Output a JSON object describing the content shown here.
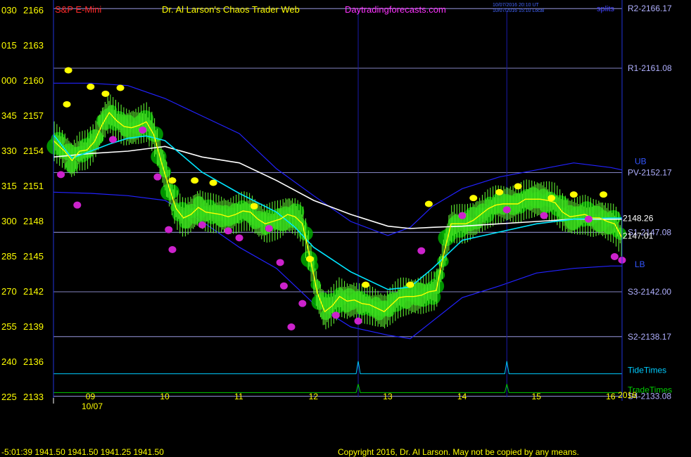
{
  "header": {
    "symbol": "S&P E-Mini",
    "title": "Dr. Al Larson's Chaos Trader Web",
    "site": "Daytradingforecasts.com",
    "stamp_line1": "10/07/2016 20:10 UT",
    "stamp_line2": "10/07/2016 15:10 Local",
    "corner_tag": "splits"
  },
  "footer": {
    "quote": "-5:01:39  1941.50  1941.50  1941.25  1941.50",
    "copyright": "Copyright 2016, Dr. Al Larson. May not be copied by any means."
  },
  "colors": {
    "background": "#000000",
    "price_line": "#ffff00",
    "ema_cyan": "#00e5ff",
    "ema_white": "#ffffff",
    "bands": "#2222ff",
    "pivot_lines": "#b0b0ff",
    "tide_times": "#00ccff",
    "trade_times": "#00cc00",
    "green_blob": "#00aa00",
    "magenta_marker": "#cc22cc",
    "yellow_marker": "#ffff00"
  },
  "chart_data": {
    "type": "line",
    "title": "S&P E-Mini",
    "ylim": [
      2133,
      2166
    ],
    "xlim": [
      8.5,
      16.15
    ],
    "date_label": "10/07",
    "year_label": "2016",
    "left_axis_ticks": [
      {
        "time": "030",
        "price": "2166"
      },
      {
        "time": "015",
        "price": "2163"
      },
      {
        "time": "000",
        "price": "2160"
      },
      {
        "time": "345",
        "price": "2157"
      },
      {
        "time": "330",
        "price": "2154"
      },
      {
        "time": "315",
        "price": "2151"
      },
      {
        "time": "300",
        "price": "2148"
      },
      {
        "time": "285",
        "price": "2145"
      },
      {
        "time": "270",
        "price": "2142"
      },
      {
        "time": "255",
        "price": "2139"
      },
      {
        "time": "240",
        "price": "2136"
      },
      {
        "time": "225",
        "price": "2133"
      }
    ],
    "x_ticks": [
      {
        "label": "09",
        "x": 9
      },
      {
        "label": "10",
        "x": 10
      },
      {
        "label": "11",
        "x": 11
      },
      {
        "label": "12",
        "x": 12
      },
      {
        "label": "13",
        "x": 13
      },
      {
        "label": "14",
        "x": 14
      },
      {
        "label": "15",
        "x": 15
      },
      {
        "label": "16",
        "x": 16
      }
    ],
    "levels": [
      {
        "label": "R2-2166.17",
        "value": 2166.17
      },
      {
        "label": "R1-2161.08",
        "value": 2161.08
      },
      {
        "label": "PV-2152.17",
        "value": 2152.17
      },
      {
        "label": "S1-2147.08",
        "value": 2147.08
      },
      {
        "label": "S3-2142.00",
        "value": 2142.0
      },
      {
        "label": "S2-2138.17",
        "value": 2138.17
      },
      {
        "label": "S4-2133.08",
        "value": 2133.08
      }
    ],
    "band_labels": {
      "upper": "UB",
      "lower": "LB"
    },
    "ema_values": [
      "2148.26",
      "2147.01"
    ],
    "timing_lines": [
      {
        "label": "TideTimes",
        "value": 2135.0,
        "peaks_x": [
          12.6,
          14.6
        ]
      },
      {
        "label": "TradeTimes",
        "value": 2133.4,
        "peaks_x": [
          12.6,
          14.6
        ]
      }
    ],
    "vertical_markers_x": [
      12.6,
      14.6
    ],
    "series": [
      {
        "key": "price",
        "x": [
          8.5,
          8.65,
          8.75,
          8.85,
          8.95,
          9.05,
          9.15,
          9.25,
          9.35,
          9.45,
          9.55,
          9.65,
          9.75,
          9.85,
          9.95,
          10.05,
          10.15,
          10.25,
          10.35,
          10.45,
          10.55,
          10.65,
          10.75,
          10.85,
          10.95,
          11.05,
          11.15,
          11.25,
          11.35,
          11.45,
          11.55,
          11.65,
          11.75,
          11.85,
          11.95,
          12.05,
          12.15,
          12.25,
          12.35,
          12.45,
          12.55,
          12.65,
          12.75,
          12.85,
          12.95,
          13.05,
          13.15,
          13.25,
          13.35,
          13.45,
          13.55,
          13.65,
          13.75,
          13.85,
          13.95,
          14.05,
          14.15,
          14.25,
          14.35,
          14.45,
          14.55,
          14.65,
          14.75,
          14.85,
          14.95,
          15.05,
          15.15,
          15.25,
          15.35,
          15.45,
          15.55,
          15.65,
          15.75,
          15.85,
          15.95,
          16.05,
          16.15
        ],
        "values": [
          2154.9,
          2154.0,
          2153.2,
          2154.0,
          2154.1,
          2154.8,
          2156.2,
          2157.3,
          2156.6,
          2156.1,
          2156.0,
          2156.2,
          2156.5,
          2155.4,
          2153.1,
          2151.0,
          2149.1,
          2148.3,
          2148.6,
          2149.2,
          2148.8,
          2148.7,
          2148.6,
          2148.4,
          2148.6,
          2148.9,
          2148.8,
          2148.2,
          2147.8,
          2148.0,
          2148.2,
          2148.6,
          2148.4,
          2147.8,
          2145.0,
          2141.9,
          2140.3,
          2140.8,
          2141.6,
          2141.2,
          2141.3,
          2141.0,
          2140.9,
          2140.6,
          2140.3,
          2140.9,
          2141.5,
          2141.6,
          2141.6,
          2141.7,
          2142.0,
          2142.1,
          2145.2,
          2147.8,
          2147.8,
          2147.8,
          2148.1,
          2148.6,
          2149.1,
          2149.4,
          2149.5,
          2149.5,
          2149.5,
          2149.9,
          2149.9,
          2149.9,
          2149.8,
          2149.6,
          2148.8,
          2148.4,
          2148.5,
          2148.6,
          2148.3,
          2148.3,
          2148.0,
          2147.8,
          2146.6
        ]
      },
      {
        "key": "ema_cyan",
        "x": [
          8.5,
          8.75,
          9.0,
          9.25,
          9.5,
          9.75,
          10.0,
          10.5,
          11.0,
          11.5,
          11.75,
          12.0,
          12.5,
          13.0,
          13.3,
          13.6,
          14.0,
          14.5,
          15.0,
          15.5,
          16.0,
          16.15
        ],
        "values": [
          2155.4,
          2153.4,
          2154.0,
          2154.6,
          2155.1,
          2155.3,
          2154.9,
          2152.2,
          2150.4,
          2148.8,
          2147.5,
          2145.8,
          2143.7,
          2142.2,
          2142.4,
          2144.0,
          2146.4,
          2147.1,
          2147.8,
          2148.2,
          2148.3,
          2148.3
        ]
      },
      {
        "key": "ema_white",
        "x": [
          8.5,
          9.0,
          9.5,
          10.0,
          10.5,
          11.0,
          11.5,
          12.0,
          12.5,
          13.0,
          13.3,
          13.6,
          14.0,
          14.5,
          15.0,
          15.5,
          16.0,
          16.15
        ],
        "values": [
          2153.5,
          2153.8,
          2154.0,
          2154.4,
          2153.5,
          2153.0,
          2151.5,
          2149.8,
          2148.6,
          2147.6,
          2147.4,
          2147.5,
          2147.6,
          2147.8,
          2148.0,
          2148.2,
          2148.2,
          2148.2
        ]
      },
      {
        "key": "upper_band",
        "x": [
          8.5,
          9.0,
          9.5,
          10.0,
          10.5,
          11.0,
          11.5,
          12.0,
          12.5,
          13.0,
          13.3,
          13.6,
          14.0,
          14.5,
          15.0,
          15.5,
          16.0,
          16.15
        ],
        "values": [
          2159.8,
          2159.8,
          2159.6,
          2158.5,
          2157.0,
          2155.5,
          2152.5,
          2150.2,
          2148.0,
          2146.8,
          2147.5,
          2149.3,
          2150.8,
          2151.8,
          2152.4,
          2153.0,
          2152.6,
          2152.4
        ]
      },
      {
        "key": "lower_band",
        "x": [
          8.5,
          9.0,
          9.5,
          10.0,
          10.5,
          11.0,
          11.5,
          12.0,
          12.5,
          13.0,
          13.3,
          13.6,
          14.0,
          14.5,
          15.0,
          15.5,
          16.0,
          16.15
        ],
        "values": [
          2150.5,
          2150.4,
          2150.2,
          2149.8,
          2148.0,
          2145.8,
          2144.0,
          2141.0,
          2139.0,
          2138.3,
          2138.0,
          2139.5,
          2141.5,
          2142.5,
          2143.6,
          2144.0,
          2144.2,
          2144.2
        ]
      }
    ],
    "yellow_markers": [
      {
        "x": 8.7,
        "y": 2160.9
      },
      {
        "x": 8.68,
        "y": 2158.0
      },
      {
        "x": 9.0,
        "y": 2159.5
      },
      {
        "x": 9.2,
        "y": 2158.9
      },
      {
        "x": 9.4,
        "y": 2159.4
      },
      {
        "x": 10.1,
        "y": 2151.5
      },
      {
        "x": 10.4,
        "y": 2151.5
      },
      {
        "x": 10.65,
        "y": 2151.3
      },
      {
        "x": 11.2,
        "y": 2149.3
      },
      {
        "x": 11.95,
        "y": 2144.8
      },
      {
        "x": 12.7,
        "y": 2142.6
      },
      {
        "x": 13.3,
        "y": 2142.6
      },
      {
        "x": 13.55,
        "y": 2149.5
      },
      {
        "x": 14.15,
        "y": 2150.0
      },
      {
        "x": 14.5,
        "y": 2150.5
      },
      {
        "x": 14.75,
        "y": 2151.0
      },
      {
        "x": 15.2,
        "y": 2150.0
      },
      {
        "x": 15.5,
        "y": 2150.3
      },
      {
        "x": 15.9,
        "y": 2150.3
      }
    ],
    "magenta_markers": [
      {
        "x": 8.6,
        "y": 2152.0
      },
      {
        "x": 8.82,
        "y": 2149.4
      },
      {
        "x": 9.3,
        "y": 2155.0
      },
      {
        "x": 9.7,
        "y": 2155.8
      },
      {
        "x": 9.9,
        "y": 2151.8
      },
      {
        "x": 10.05,
        "y": 2147.3
      },
      {
        "x": 10.1,
        "y": 2145.6
      },
      {
        "x": 10.5,
        "y": 2147.7
      },
      {
        "x": 10.85,
        "y": 2147.2
      },
      {
        "x": 11.0,
        "y": 2146.6
      },
      {
        "x": 11.4,
        "y": 2147.4
      },
      {
        "x": 11.55,
        "y": 2144.5
      },
      {
        "x": 11.6,
        "y": 2142.5
      },
      {
        "x": 11.7,
        "y": 2139.0
      },
      {
        "x": 11.85,
        "y": 2141.0
      },
      {
        "x": 12.3,
        "y": 2140.0
      },
      {
        "x": 12.6,
        "y": 2139.5
      },
      {
        "x": 13.45,
        "y": 2145.5
      },
      {
        "x": 14.0,
        "y": 2148.5
      },
      {
        "x": 14.6,
        "y": 2149.0
      },
      {
        "x": 15.1,
        "y": 2148.5
      },
      {
        "x": 15.7,
        "y": 2148.2
      },
      {
        "x": 16.05,
        "y": 2145.0
      },
      {
        "x": 16.15,
        "y": 2144.7
      }
    ]
  }
}
